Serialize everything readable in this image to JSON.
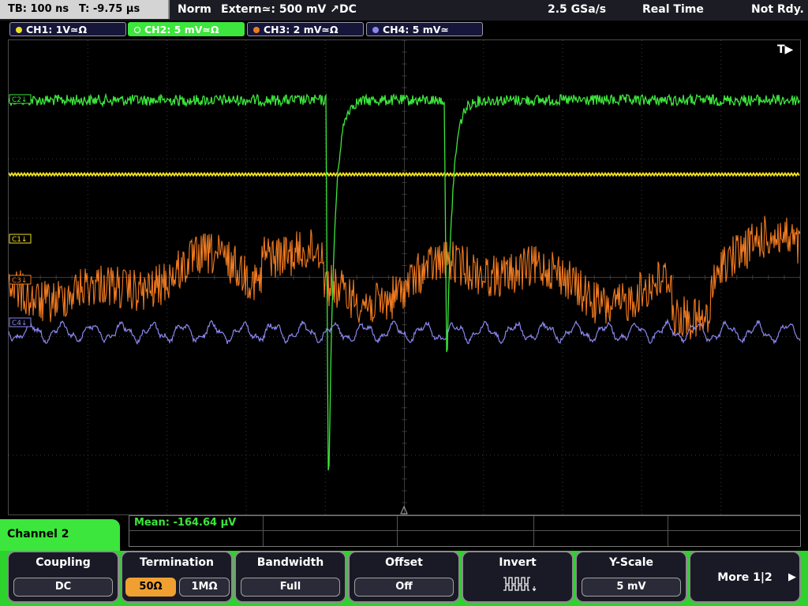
{
  "topbar": {
    "timebase": "TB: 100 ns",
    "trigger_time": "T: -9.75 µs",
    "acq_mode": "Norm",
    "trigger_source": "Extern≃: 500 mV ↗DC",
    "sample_rate": "2.5 GSa/s",
    "time_mode": "Real Time",
    "status": "Not Rdy."
  },
  "channels": [
    {
      "label": "CH1: 1V≃Ω",
      "color": "#f0e020"
    },
    {
      "label": "CH2: 5 mV≃Ω",
      "color": "#3ce63c"
    },
    {
      "label": "CH3: 2 mV≃Ω",
      "color": "#f07a20"
    },
    {
      "label": "CH4: 5 mV≃",
      "color": "#8a86ee"
    }
  ],
  "markers": {
    "trigger_tag": "T▶",
    "c1": "C1↓",
    "c2": "C2↓",
    "c3": "C3↓",
    "c4": "C4↓"
  },
  "measurement": {
    "text": "Mean: -164.64 µV"
  },
  "menu_title": "Channel 2",
  "softkeys": {
    "coupling": {
      "label": "Coupling",
      "value": "DC"
    },
    "termination": {
      "label": "Termination",
      "opt1": "50Ω",
      "opt2": "1MΩ"
    },
    "bandwidth": {
      "label": "Bandwidth",
      "value": "Full"
    },
    "offset": {
      "label": "Offset",
      "value": "Off"
    },
    "invert": {
      "label": "Invert"
    },
    "yscale": {
      "label": "Y-Scale",
      "value": "5 mV"
    },
    "more": {
      "label": "More 1|2",
      "arrow": "▶"
    }
  },
  "colors": {
    "ch1": "#f0e020",
    "ch2": "#3ce63c",
    "ch3": "#f07a20",
    "ch4": "#8a86ee",
    "grid": "#3a3a3a"
  },
  "icons": {
    "invert": "pulse-train-icon",
    "more_arrow": "right-triangle-icon"
  }
}
